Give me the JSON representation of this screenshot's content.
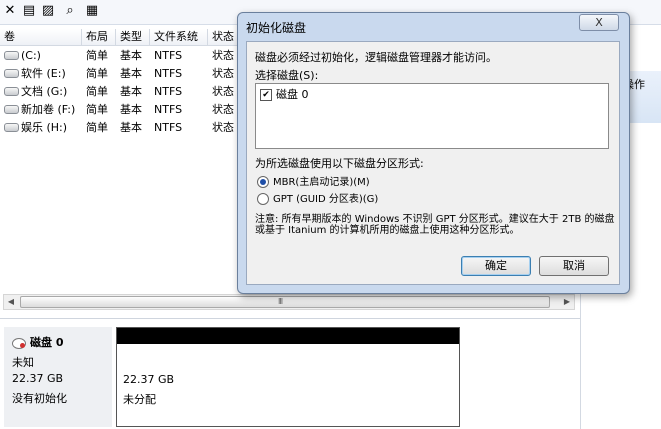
{
  "toolbar": {
    "icons": [
      "close-icon",
      "properties-icon",
      "open-folder-icon",
      "search-icon",
      "settings-icon"
    ]
  },
  "volume_table": {
    "columns": [
      "卷",
      "布局",
      "类型",
      "文件系统",
      "状态"
    ],
    "rows": [
      {
        "name": "(C:)",
        "layout": "简单",
        "type": "基本",
        "fs": "NTFS",
        "status": "状态"
      },
      {
        "name": "软件 (E:)",
        "layout": "简单",
        "type": "基本",
        "fs": "NTFS",
        "status": "状态"
      },
      {
        "name": "文档 (G:)",
        "layout": "简单",
        "type": "基本",
        "fs": "NTFS",
        "status": "状态"
      },
      {
        "name": "新加卷 (F:)",
        "layout": "简单",
        "type": "基本",
        "fs": "NTFS",
        "status": "状态"
      },
      {
        "name": "娱乐 (H:)",
        "layout": "简单",
        "type": "基本",
        "fs": "NTFS",
        "status": "状态"
      }
    ]
  },
  "action_pane": {
    "label": "操作"
  },
  "scrollbar": {
    "grip": "III"
  },
  "disk": {
    "name": "磁盘 0",
    "kind": "未知",
    "size": "22.37 GB",
    "state": "没有初始化",
    "partition": {
      "size": "22.37 GB",
      "state": "未分配"
    }
  },
  "dialog": {
    "title": "初始化磁盘",
    "close": "X",
    "intro": "磁盘必须经过初始化，逻辑磁盘管理器才能访问。",
    "select_label": "选择磁盘(S):",
    "disks": [
      {
        "label": "磁盘 0",
        "checked": "✔"
      }
    ],
    "partition_style_label": "为所选磁盘使用以下磁盘分区形式:",
    "options": [
      {
        "label": "MBR(主启动记录)(M)"
      },
      {
        "label": "GPT (GUID 分区表)(G)"
      }
    ],
    "note": "注意: 所有早期版本的 Windows 不识别 GPT 分区形式。建议在大于 2TB 的磁盘或基于 Itanium 的计算机所用的磁盘上使用这种分区形式。",
    "ok": "确定",
    "cancel": "取消"
  }
}
